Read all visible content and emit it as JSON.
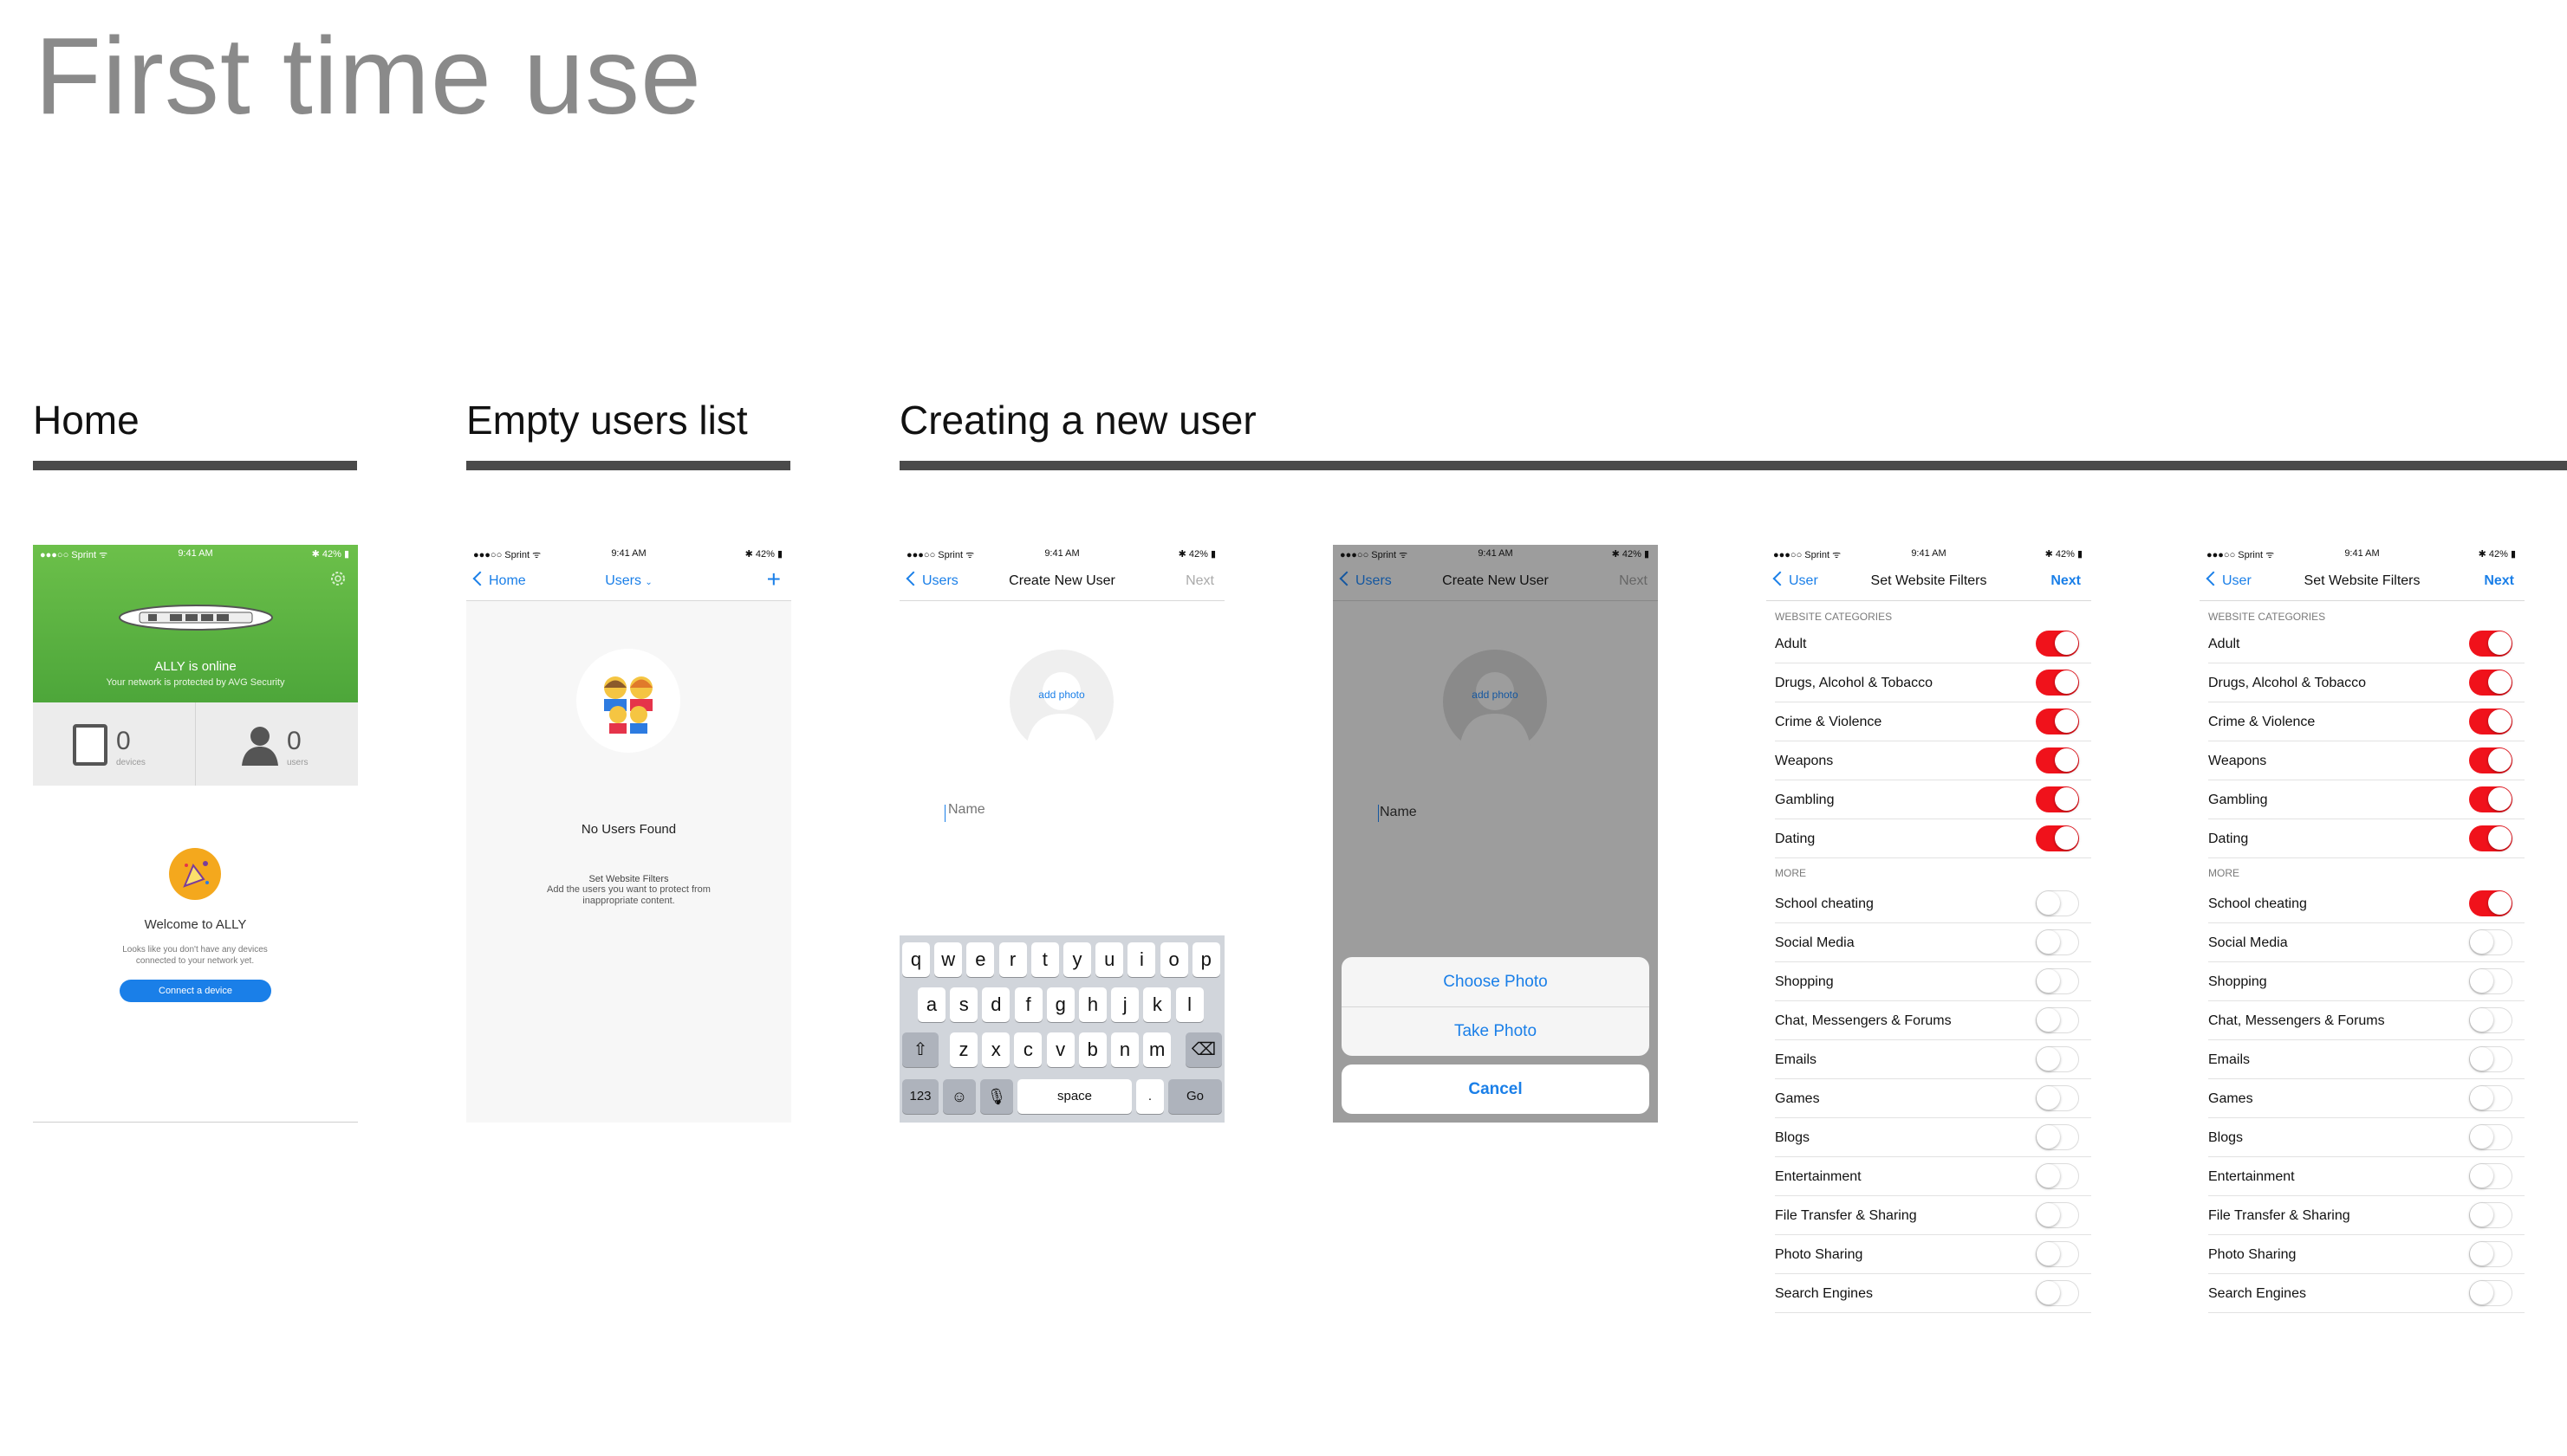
{
  "page_title": "First time use",
  "sections": {
    "home": "Home",
    "empty_users": "Empty users list",
    "creating_user": "Creating a new user"
  },
  "status": {
    "carrier": "●●●○○ Sprint ᯤ",
    "time": "9:41 AM",
    "battery": "✱ 42% ▮"
  },
  "home": {
    "online_title": "ALLY is online",
    "online_sub": "Your network is protected by AVG Security",
    "devices_count": "0",
    "devices_label": "devices",
    "users_count": "0",
    "users_label": "users",
    "welcome_title": "Welcome to ALLY",
    "welcome_text": "Looks like you don't have any devices connected to your network yet.",
    "connect_button": "Connect a device",
    "accent": "#6cc04a",
    "button_color": "#1a7fe8"
  },
  "empty": {
    "back": "Home",
    "title": "Users",
    "plus": "+",
    "no_users": "No Users Found",
    "filters_title": "Set Website Filters",
    "filters_text": "Add the users you want to protect from inappropriate content."
  },
  "create": {
    "back": "Users",
    "title": "Create New User",
    "next": "Next",
    "add_photo": "add photo",
    "name_placeholder": "Name",
    "keys_row1": [
      "q",
      "w",
      "e",
      "r",
      "t",
      "y",
      "u",
      "i",
      "o",
      "p"
    ],
    "keys_row2": [
      "a",
      "s",
      "d",
      "f",
      "g",
      "h",
      "j",
      "k",
      "l"
    ],
    "keys_row3": [
      "z",
      "x",
      "c",
      "v",
      "b",
      "n",
      "m"
    ],
    "key_123": "123",
    "key_space": "space",
    "key_dot": ".",
    "key_go": "Go"
  },
  "sheet": {
    "choose": "Choose Photo",
    "take": "Take Photo",
    "cancel": "Cancel"
  },
  "filters": {
    "back": "User",
    "title": "Set Website Filters",
    "next": "Next",
    "cat_header": "WEBSITE CATEGORIES",
    "more_header": "MORE",
    "categories": [
      "Adult",
      "Drugs, Alcohol & Tobacco",
      "Crime & Violence",
      "Weapons",
      "Gambling",
      "Dating"
    ],
    "more": [
      "School cheating",
      "Social Media",
      "Shopping",
      "Chat, Messengers & Forums",
      "Emails",
      "Games",
      "Blogs",
      "Entertainment",
      "File Transfer & Sharing",
      "Photo Sharing",
      "Search Engines"
    ],
    "toggle_on_color": "#f0121b"
  }
}
